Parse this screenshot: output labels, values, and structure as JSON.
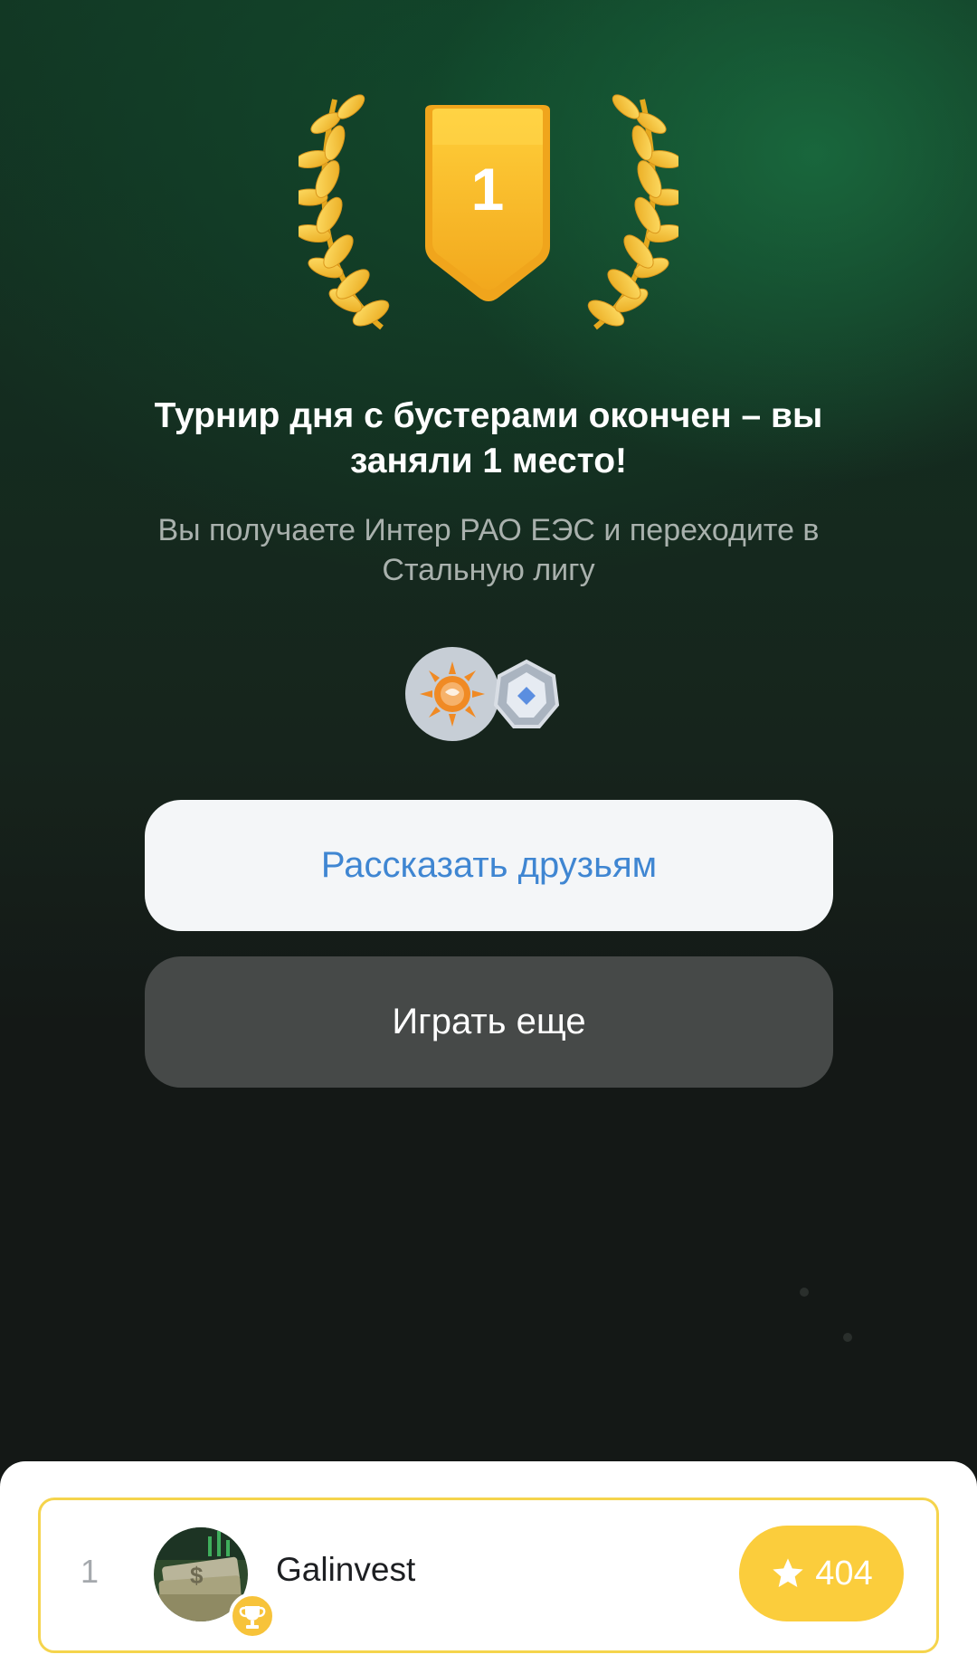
{
  "badge": {
    "place": "1"
  },
  "result": {
    "title": "Турнир дня с бустерами окончен – вы заняли 1 место!",
    "subtitle": "Вы получаете Интер РАО ЕЭС и переходите в Стальную лигу"
  },
  "rewards": [
    {
      "icon": "inter-rao-logo-icon"
    },
    {
      "icon": "steel-league-badge-icon"
    }
  ],
  "buttons": {
    "share_label": "Рассказать друзьям",
    "play_label": "Играть еще"
  },
  "leaderboard": {
    "rows": [
      {
        "rank": "1",
        "username": "Galinvest",
        "score": "404",
        "avatar_icon": "money-stack-avatar",
        "badge_icon": "trophy-icon",
        "score_icon": "star-icon"
      }
    ]
  },
  "colors": {
    "accent_gold": "#f7c33a",
    "share_text": "#3f86d2",
    "row_border": "#f5d44c"
  }
}
